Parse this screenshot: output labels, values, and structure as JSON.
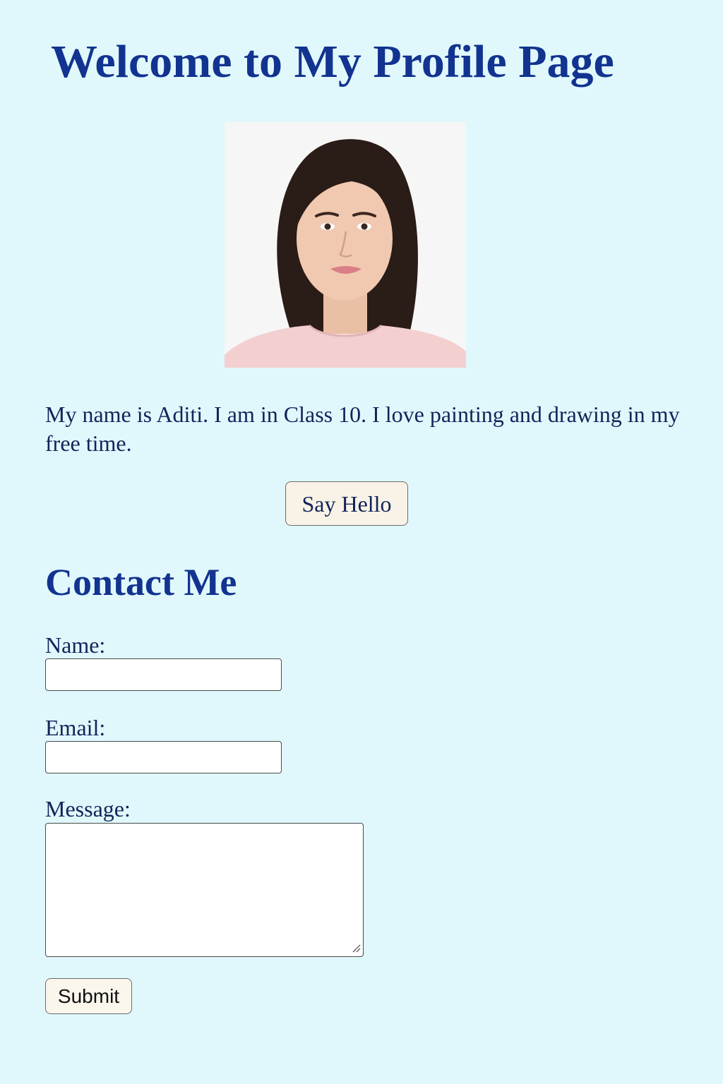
{
  "page": {
    "title": "Welcome to My Profile Page",
    "bio": "My name is Aditi. I am in Class 10. I love painting and drawing in my free time.",
    "say_hello_label": "Say Hello"
  },
  "profile_photo": {
    "subject": "portrait photo of a young woman with shoulder-length dark hair in a pink top"
  },
  "contact": {
    "heading": "Contact Me",
    "name_label": "Name:",
    "name_value": "",
    "email_label": "Email:",
    "email_value": "",
    "message_label": "Message:",
    "message_value": "",
    "submit_label": "Submit"
  },
  "colors": {
    "background": "#e0f8fc",
    "heading": "#12338f",
    "text": "#13245a",
    "button_bg": "#f8f3e6"
  }
}
